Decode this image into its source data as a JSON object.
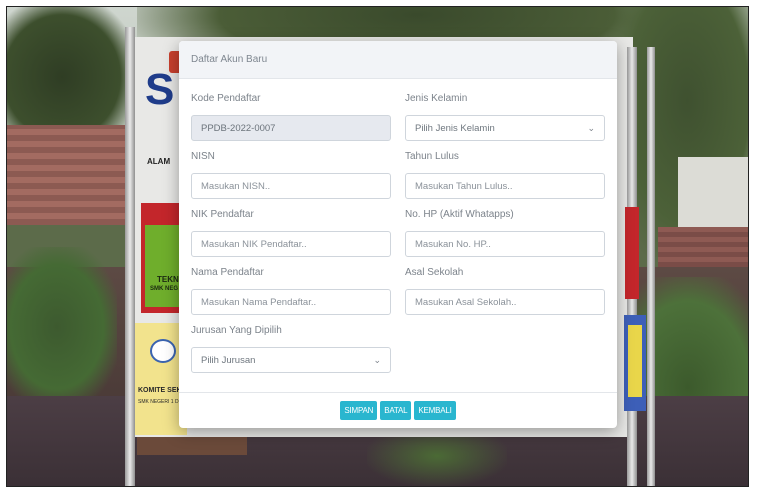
{
  "modal": {
    "title": "Daftar Akun Baru",
    "fields": {
      "kode_pendaftar": {
        "label": "Kode Pendaftar",
        "value": "PPDB-2022-0007"
      },
      "jenis_kelamin": {
        "label": "Jenis Kelamin",
        "selected": "Pilih Jenis Kelamin"
      },
      "nisn": {
        "label": "NISN",
        "placeholder": "Masukan NISN.."
      },
      "tahun_lulus": {
        "label": "Tahun Lulus",
        "placeholder": "Masukan Tahun Lulus.."
      },
      "nik_pendaftar": {
        "label": "NIK Pendaftar",
        "placeholder": "Masukan NIK Pendaftar.."
      },
      "no_hp": {
        "label": "No. HP (Aktif Whatapps)",
        "placeholder": "Masukan No. HP.."
      },
      "nama_pendaftar": {
        "label": "Nama Pendaftar",
        "placeholder": "Masukan Nama Pendaftar.."
      },
      "asal_sekolah": {
        "label": "Asal Sekolah",
        "placeholder": "Masukan Asal Sekolah.."
      },
      "jurusan": {
        "label": "Jurusan Yang Dipilih",
        "selected": "Pilih Jurusan"
      }
    },
    "buttons": {
      "simpan": "SIMPAN",
      "batal": "BATAL",
      "kembali": "KEMBALI"
    },
    "accent_color": "#29b6cf"
  },
  "background": {
    "sign_letter": "S",
    "sign_alamat": "ALAM",
    "sign_tekn": "TEKN",
    "sign_smk": "SMK NEG",
    "sign_komite": "KOMITE SEK",
    "sign_komite_sub": "SMK NEGERI 1 DUR"
  }
}
